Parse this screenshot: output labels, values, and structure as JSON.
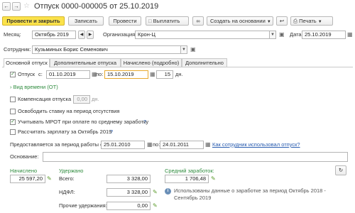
{
  "window": {
    "title": "Отпуск 0000-000005 от 25.10.2019"
  },
  "toolbar": {
    "post_close": "Провести и закрыть",
    "save": "Записать",
    "post": "Провести",
    "pay": "Выплатить",
    "create_based": "Создать на основании",
    "print": "Печать"
  },
  "header": {
    "month_label": "Месяц:",
    "month_value": "Октябрь 2019",
    "org_label": "Организация:",
    "org_value": "Крон-Ц",
    "date_label": "Дата:",
    "date_value": "25.10.2019",
    "employee_label": "Сотрудник:",
    "employee_value": "Кузьминых Борис Семенович"
  },
  "tabs": [
    "Основной отпуск",
    "Дополнительные отпуска",
    "Начислено (подробно)",
    "Дополнительно"
  ],
  "main": {
    "vacation_label": "Отпуск",
    "from_label": "с:",
    "from_value": "01.10.2019",
    "to_label": "по:",
    "to_value": "15.10.2019",
    "days_value": "15",
    "days_unit": "дн.",
    "time_kind": "Вид времени (ОТ)",
    "compensation_label": "Компенсация отпуска",
    "compensation_value": "0,00",
    "compensation_unit": "дн.",
    "release_rate": "Освободить ставку на период отсутствия",
    "mrot": "Учитывать МРОТ при оплате по среднему заработку",
    "calc_salary": "Рассчитать зарплату за Октябрь 2019",
    "help": "?",
    "period_label": "Предоставляется за период работы с:",
    "period_from": "25.01.2010",
    "period_to_label": "по:",
    "period_to": "24.01.2011",
    "vacation_used_link": "Как сотрудник использовал отпуск?",
    "basis_label": "Основание:"
  },
  "totals": {
    "accrued_label": "Начислено",
    "accrued_value": "25 597,20",
    "withheld_label": "Удержано",
    "total_label": "Всего:",
    "total_value": "3 328,00",
    "ndfl_label": "НДФЛ:",
    "ndfl_value": "3 328,00",
    "other_label": "Прочие удержания:",
    "other_value": "0,00",
    "avg_label": "Средний заработок:",
    "avg_value": "1 706,48",
    "info_text": "Использованы данные о заработке за период Октябрь 2018 - Сентябрь 2019"
  },
  "colors": {
    "primary_button": "#fbe24a",
    "green": "#2e8b3d",
    "link": "#2a5db0"
  }
}
